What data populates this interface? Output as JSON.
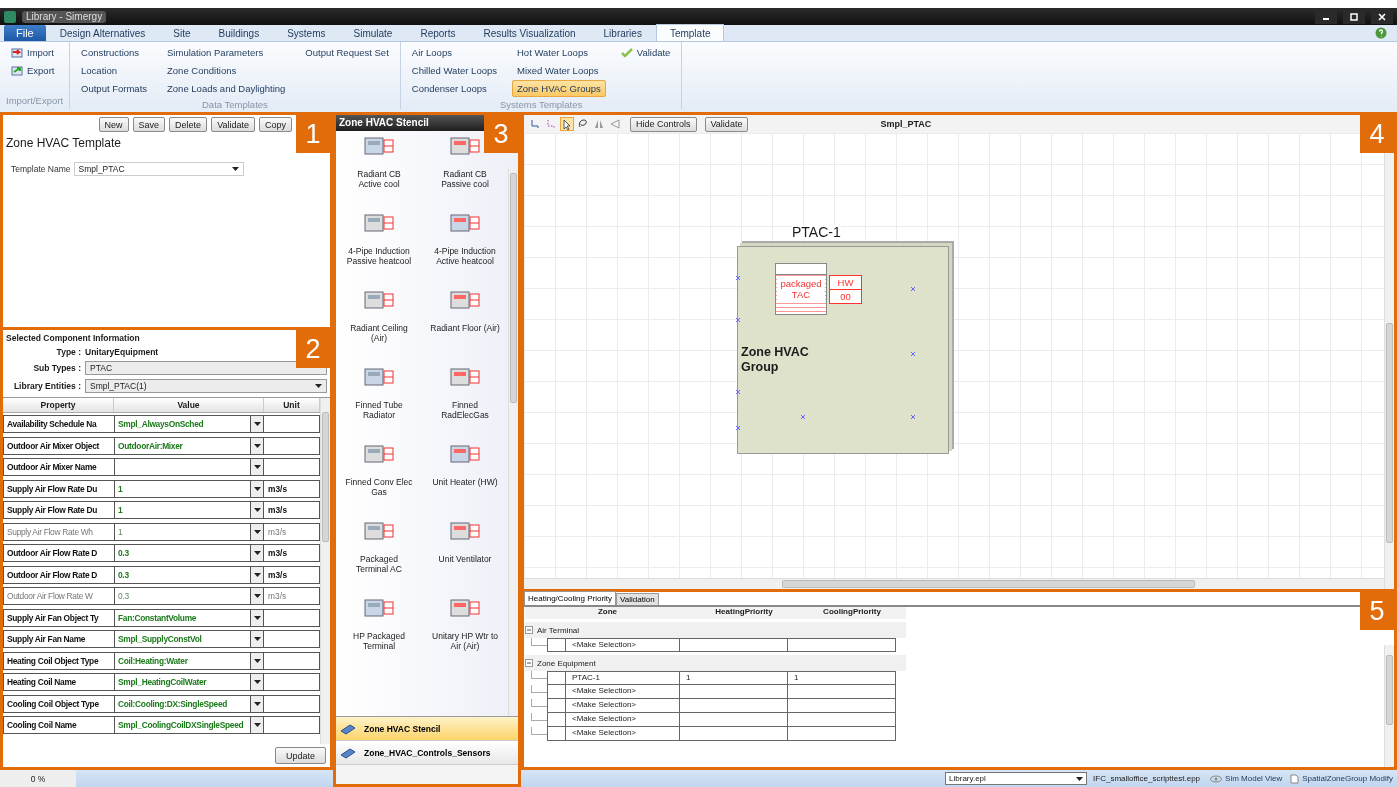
{
  "window": {
    "title": "Library - Simergy"
  },
  "ribbon": {
    "file_tab": "File",
    "tabs": [
      {
        "label": "Design Alternatives",
        "selected": false
      },
      {
        "label": "Site",
        "selected": false
      },
      {
        "label": "Buildings",
        "selected": false
      },
      {
        "label": "Systems",
        "selected": false
      },
      {
        "label": "Simulate",
        "selected": false
      },
      {
        "label": "Reports",
        "selected": false
      },
      {
        "label": "Results Visualization",
        "selected": false
      },
      {
        "label": "Libraries",
        "selected": false
      },
      {
        "label": "Template",
        "selected": true
      }
    ],
    "groups": [
      {
        "label": "Import/Export",
        "columns": [
          [
            {
              "label": "Import",
              "kind": "import",
              "selected": false
            },
            {
              "label": "Export",
              "kind": "export",
              "selected": false
            }
          ]
        ]
      },
      {
        "label": "Data Templates",
        "columns": [
          [
            {
              "label": "Constructions",
              "selected": false
            },
            {
              "label": "Location",
              "selected": false
            },
            {
              "label": "Output Formats",
              "selected": false
            }
          ],
          [
            {
              "label": "Simulation Parameters",
              "selected": false
            },
            {
              "label": "Zone Conditions",
              "selected": false
            },
            {
              "label": "Zone Loads and Daylighting",
              "selected": false
            }
          ],
          [
            {
              "label": "Output Request Set",
              "selected": false
            }
          ]
        ]
      },
      {
        "label": "Systems Templates",
        "columns": [
          [
            {
              "label": "Air Loops",
              "selected": false
            },
            {
              "label": "Chilled Water Loops",
              "selected": false
            },
            {
              "label": "Condenser Loops",
              "selected": false
            }
          ],
          [
            {
              "label": "Hot Water Loops",
              "selected": false
            },
            {
              "label": "Mixed Water Loops",
              "selected": false
            },
            {
              "label": "Zone HVAC Groups",
              "selected": true
            }
          ],
          [
            {
              "label": "Validate",
              "kind": "check",
              "selected": false
            }
          ]
        ]
      }
    ]
  },
  "template_panel": {
    "callout": "1",
    "buttons": [
      "New",
      "Save",
      "Delete",
      "Validate",
      "Copy"
    ],
    "title": "Zone HVAC Template",
    "template_name": {
      "label": "Template Name",
      "value": "Smpl_PTAC"
    }
  },
  "component_panel": {
    "callout": "2",
    "heading": "Selected Component Information",
    "type": {
      "label": "Type :",
      "value": "UnitaryEquipment"
    },
    "sub_types": {
      "label": "Sub Types :",
      "value": "PTAC"
    },
    "library_entities": {
      "label": "Library Entities :",
      "value": "Smpl_PTAC(1)"
    },
    "columns": [
      "Property",
      "Value",
      "Unit"
    ],
    "rows": [
      {
        "property": "Availability Schedule Na",
        "value": "Smpl_AlwaysOnSched",
        "disabled": false
      },
      {
        "property": "Outdoor Air Mixer Object",
        "value": "OutdoorAir:Mixer",
        "disabled": false
      },
      {
        "property": "Outdoor Air Mixer Name",
        "disabled": false
      },
      {
        "property": "Supply Air Flow Rate Du",
        "value": "1",
        "unit": "m3/s",
        "disabled": false
      },
      {
        "property": "Supply Air Flow Rate Du",
        "value": "1",
        "unit": "m3/s",
        "disabled": false
      },
      {
        "property": "Supply Air Flow Rate Wh",
        "value": "1",
        "unit": "m3/s",
        "disabled": true
      },
      {
        "property": "Outdoor Air Flow Rate D",
        "value": "0.3",
        "unit": "m3/s",
        "disabled": false
      },
      {
        "property": "Outdoor Air Flow Rate D",
        "value": "0.3",
        "unit": "m3/s",
        "disabled": false
      },
      {
        "property": "Outdoor Air Flow Rate W",
        "value": "0.3",
        "unit": "m3/s",
        "disabled": true
      },
      {
        "property": "Supply Air Fan Object Ty",
        "value": "Fan:ConstantVolume",
        "disabled": false
      },
      {
        "property": "Supply Air Fan Name",
        "value": "Smpl_SupplyConstVol",
        "disabled": false
      },
      {
        "property": "Heating Coil Object Type",
        "value": "Coil:Heating:Water",
        "disabled": false
      },
      {
        "property": "Heating Coil Name",
        "value": "Smpl_HeatingCoilWater",
        "disabled": false
      },
      {
        "property": "Cooling Coil Object Type",
        "value": "Coil:Cooling:DX:SingleSpeed",
        "disabled": false
      },
      {
        "property": "Cooling Coil Name",
        "value": "Smpl_CoolingCoilDXSingleSpeed",
        "disabled": false
      }
    ],
    "update_button": "Update"
  },
  "stencil": {
    "callout": "3",
    "title": "Zone HVAC Stencil",
    "items": [
      "Radiant CB\nActive cool",
      "Radiant CB\nPassive cool",
      "4-Pipe Induction\nPassive heatcool",
      "4-Pipe Induction\nActive heatcool",
      "Radiant Ceiling\n(Air)",
      "Radiant Floor (Air)",
      "Finned Tube\nRadiator",
      "Finned\nRadElecGas",
      "Finned Conv Elec\nGas",
      "Unit Heater (HW)",
      "Packaged\nTerminal AC",
      "Unit Ventilator",
      "HP Packaged\nTerminal",
      "Unitary HP Wtr to\nAir (Air)"
    ],
    "libraries": [
      {
        "label": "Zone HVAC Stencil",
        "selected": true
      },
      {
        "label": "Zone_HVAC_Controls_Sensors",
        "selected": false
      }
    ]
  },
  "canvas": {
    "callout": "4",
    "tools": [
      {
        "kind": "orthogonal",
        "selected": false
      },
      {
        "kind": "dotted",
        "selected": false
      },
      {
        "kind": "pointer",
        "selected": true
      },
      {
        "kind": "lasso",
        "selected": false
      },
      {
        "kind": "flip",
        "selected": false
      },
      {
        "kind": "rotate",
        "selected": false
      }
    ],
    "buttons": [
      "Hide Controls",
      "Validate"
    ],
    "title": "Smpl_PTAC",
    "group": {
      "name": "PTAC-1",
      "label": "Zone HVAC Group",
      "unit_text": "packaged\nTAC",
      "ports": [
        "HW",
        "00"
      ]
    }
  },
  "priority_panel": {
    "callout": "5",
    "tabs": [
      {
        "label": "Heating/Cooling Priority",
        "selected": true
      },
      {
        "label": "Validation",
        "selected": false
      }
    ],
    "columns": [
      "Zone",
      "HeatingPriority",
      "CoolingPriority"
    ],
    "groups": [
      {
        "label": "Air Terminal",
        "expanded": true,
        "rows": [
          {
            "zone": "<Make Selection>"
          }
        ]
      },
      {
        "label": "Zone Equipment",
        "expanded": true,
        "rows": [
          {
            "zone": "PTAC-1",
            "heating": "1",
            "cooling": "1"
          },
          {
            "zone": "<Make Selection>"
          },
          {
            "zone": "<Make Selection>"
          },
          {
            "zone": "<Make Selection>"
          },
          {
            "zone": "<Make Selection>"
          }
        ]
      }
    ]
  },
  "status_bar": {
    "progress": "0 %",
    "library": "Library.epl",
    "file": "IFC_smalloffice_scripttest.epp",
    "links": [
      {
        "label": "Sim Model View",
        "kind": "eye"
      },
      {
        "label": "SpatialZoneGroup Modify",
        "kind": "page"
      }
    ]
  }
}
